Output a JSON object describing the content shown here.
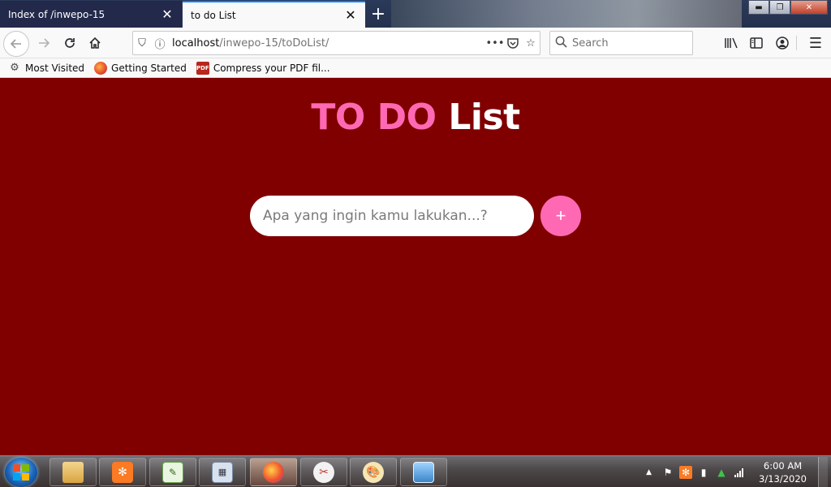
{
  "browser": {
    "tabs": [
      {
        "label": "Index of /inwepo-15",
        "active": false
      },
      {
        "label": "to do List",
        "active": true
      }
    ],
    "url": {
      "host": "localhost",
      "path": "/inwepo-15/toDoList/"
    },
    "search_placeholder": "Search",
    "bookmarks": [
      {
        "label": "Most Visited",
        "icon": "gear-icon"
      },
      {
        "label": "Getting Started",
        "icon": "firefox-icon"
      },
      {
        "label": "Compress your PDF fil...",
        "icon": "pdf-icon",
        "icon_text": "PDF"
      }
    ],
    "window_controls": {
      "minimize": "▬",
      "maximize": "❐",
      "close": "✕"
    }
  },
  "page": {
    "title_accent": "TO DO",
    "title_rest": "List",
    "input_placeholder": "Apa yang ingin kamu lakukan...?",
    "add_label": "+",
    "colors": {
      "background": "#800000",
      "accent": "#ff69b4",
      "title_text": "#ffffff"
    }
  },
  "taskbar": {
    "apps": [
      "windows-explorer",
      "xampp",
      "notepad-plus-plus",
      "calculator",
      "firefox",
      "snipping-tool",
      "paint",
      "photo-viewer"
    ],
    "clock": {
      "time": "6:00 AM",
      "date": "3/13/2020"
    }
  }
}
